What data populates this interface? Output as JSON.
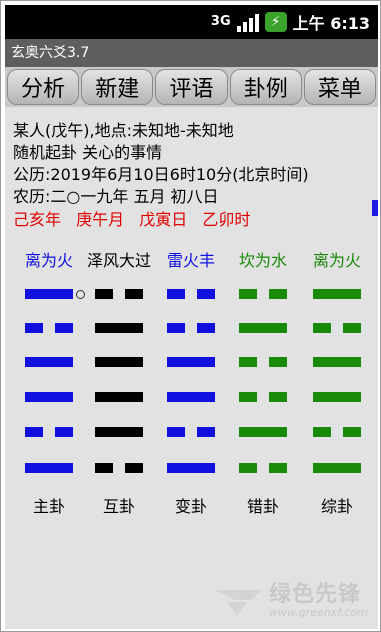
{
  "statusbar": {
    "network": "3G",
    "time": "上午 6:13"
  },
  "app": {
    "title": "玄奥六爻3.7"
  },
  "toolbar": {
    "tabs": [
      "分析",
      "新建",
      "评语",
      "卦例",
      "菜单"
    ]
  },
  "info": {
    "person": "某人(戊午),地点:未知地-未知地",
    "method": "随机起卦  关心的事情",
    "gregorian": "公历:2019年6月10日6时10分(北京时间)",
    "lunar": "农历:二○一九年 五月 初八日",
    "ganzhi": [
      "己亥年",
      "庚午月",
      "戊寅日",
      "乙卯时"
    ]
  },
  "colors": {
    "blue": "#1010e0",
    "black": "#000000",
    "green": "#1a8a0a",
    "red": "#e00000"
  },
  "hexagrams": [
    {
      "name": "离为火",
      "label": "主卦",
      "color": "blue",
      "lines": [
        "yang",
        "yin",
        "yang",
        "yang",
        "yin",
        "yang"
      ],
      "moving": [
        0
      ]
    },
    {
      "name": "泽风大过",
      "label": "互卦",
      "color": "black",
      "lines": [
        "yin",
        "yang",
        "yang",
        "yang",
        "yang",
        "yin"
      ],
      "moving": []
    },
    {
      "name": "雷火丰",
      "label": "变卦",
      "color": "blue",
      "lines": [
        "yin",
        "yin",
        "yang",
        "yang",
        "yin",
        "yang"
      ],
      "moving": []
    },
    {
      "name": "坎为水",
      "label": "错卦",
      "color": "green",
      "lines": [
        "yin",
        "yang",
        "yin",
        "yin",
        "yang",
        "yin"
      ],
      "moving": []
    },
    {
      "name": "离为火",
      "label": "综卦",
      "color": "green",
      "lines": [
        "yang",
        "yin",
        "yang",
        "yang",
        "yin",
        "yang"
      ],
      "moving": []
    }
  ],
  "watermark": {
    "cn": "绿色先锋",
    "en": "www.greenxf.com"
  }
}
